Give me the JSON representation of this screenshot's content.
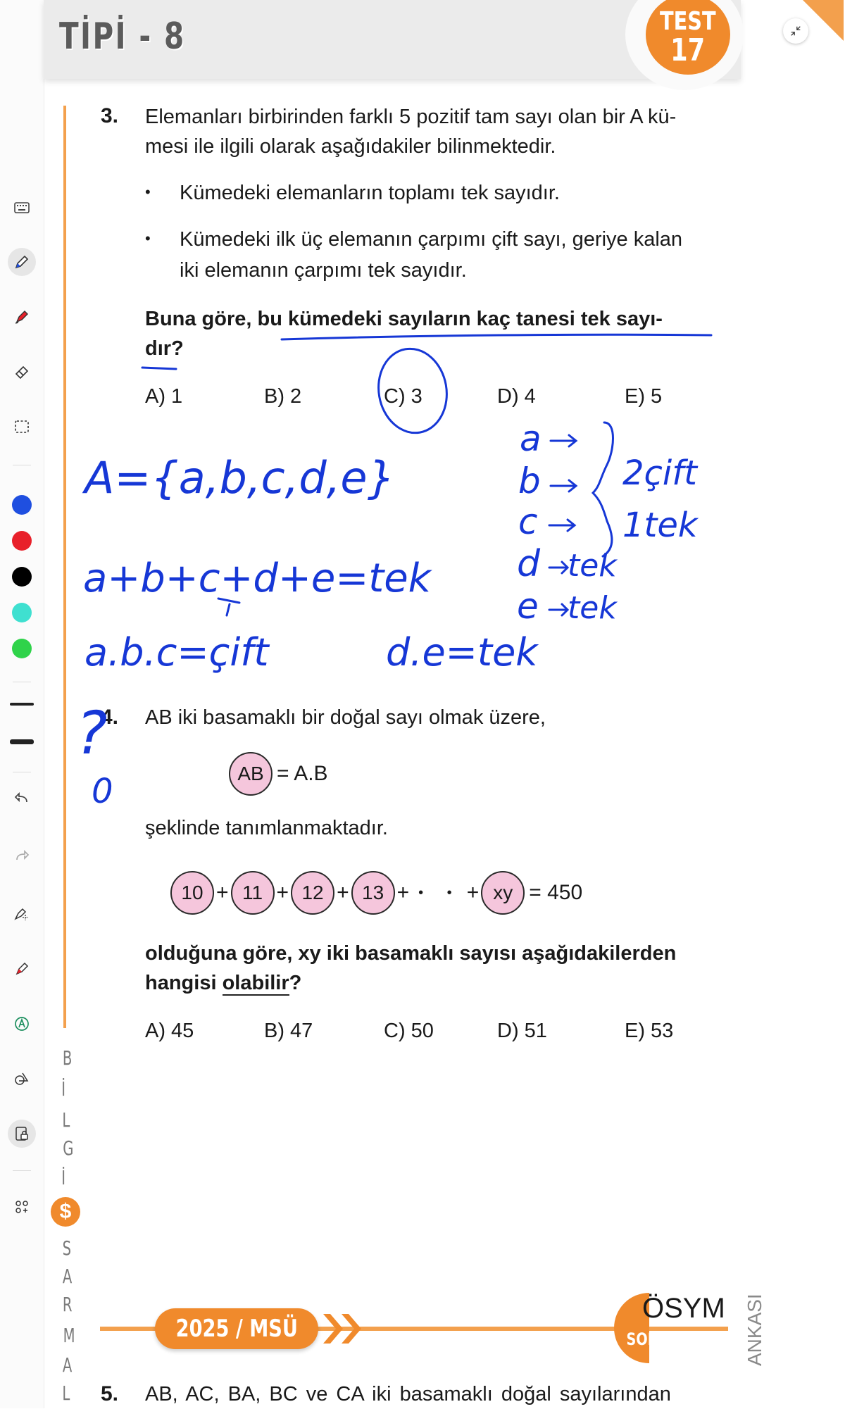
{
  "header": {
    "title": "TİPİ - 8",
    "badge_word": "TEST",
    "badge_number": "17"
  },
  "toolbar": {
    "tools": [
      "keyboard-icon",
      "pen-icon",
      "highlighter-icon",
      "eraser-icon",
      "lasso-icon"
    ],
    "colors": [
      "#1f4fe0",
      "#e8202a",
      "#000000",
      "#3fe0d0",
      "#2fd34a"
    ],
    "tools2": [
      "undo-icon",
      "redo-icon",
      "shape-pen-icon",
      "marker-icon",
      "text-icon",
      "shapes-icon",
      "lock-icon",
      "more-icon"
    ]
  },
  "q3": {
    "number": "3.",
    "line1": "Elemanları birbirinden farklı 5 pozitif tam sayı olan bir A kü-",
    "line2": "mesi ile ilgili olarak aşağıdakiler bilinmektedir.",
    "bullets": [
      "Kümedeki elemanların toplamı tek sayıdır.",
      "Kümedeki ilk üç elemanın çarpımı çift sayı, geriye kalan",
      "iki elemanın çarpımı tek sayıdır."
    ],
    "prompt1": "Buna göre, bu kümedeki sayıların kaç tanesi tek sayı-",
    "prompt2": "dır?",
    "options": [
      "A) 1",
      "B) 2",
      "C) 3",
      "D) 4",
      "E) 5"
    ]
  },
  "q4": {
    "number": "4.",
    "line1": "AB iki basamaklı bir doğal sayı olmak üzere,",
    "def_circle": "AB",
    "def_rhs": "= A.B",
    "line2": "şeklinde tanımlanmaktadır.",
    "seq": [
      "10",
      "11",
      "12",
      "13",
      "xy"
    ],
    "seq_plus": "+",
    "seq_dots": "• •",
    "seq_result": "= 450",
    "prompt1": "olduğuna göre, xy iki basamaklı sayısı aşağıdakilerden",
    "prompt2a": "hangisi ",
    "prompt2b": "olabilir",
    "prompt2c": "?",
    "options": [
      "A) 45",
      "B) 47",
      "C) 50",
      "D) 51",
      "E) 53"
    ]
  },
  "side_text": [
    "B",
    "İ",
    "L",
    "G",
    "İ",
    "S",
    "A",
    "R",
    "M",
    "A",
    "L"
  ],
  "footer": {
    "year": "2025 / MSÜ",
    "osym": "ÖSYM",
    "osym_sub": "SORDU",
    "bankasi": "ANKASI"
  },
  "q5": {
    "number": "5.",
    "line1": "AB, AC, BA, BC ve CA iki basamaklı doğal sayılarından"
  },
  "handwriting": {
    "set": "A={a,b,c,d,e}",
    "sum": "a+b+c+d+e=tek",
    "prod1": "a.b.c=çift",
    "prod2": "d.e=tek",
    "letters": [
      "a",
      "b",
      "c",
      "d",
      "e"
    ],
    "two_even": "2çift",
    "one_odd": "1tek",
    "d_odd": "tek",
    "e_odd": "tek",
    "q4_mark": "?",
    "q4_mark2": "0"
  }
}
